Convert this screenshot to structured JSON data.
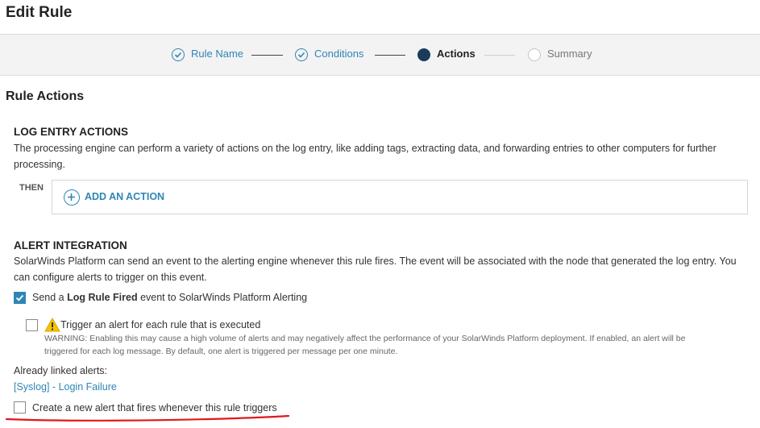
{
  "page": {
    "title": "Edit Rule"
  },
  "wizard": {
    "steps": [
      {
        "label": "Rule Name",
        "state": "done"
      },
      {
        "label": "Conditions",
        "state": "done"
      },
      {
        "label": "Actions",
        "state": "current"
      },
      {
        "label": "Summary",
        "state": "todo"
      }
    ]
  },
  "rule_actions": {
    "title": "Rule Actions"
  },
  "log_entry": {
    "title": "LOG ENTRY ACTIONS",
    "description_line1": "The processing engine can perform a variety of actions on the log entry, like adding tags, extracting data, and forwarding entries to other computers for further",
    "description_line2": "processing.",
    "then_label": "THEN",
    "add_action_label": "ADD AN ACTION"
  },
  "alert_integration": {
    "title": "ALERT INTEGRATION",
    "description_line1": "SolarWinds Platform can send an event to the alerting engine whenever this rule fires. The event will be associated with the node that generated the log entry. You",
    "description_line2": "can configure alerts to trigger on this event.",
    "send_event": {
      "checked": true,
      "label_prefix": "Send a ",
      "label_bold": "Log Rule Fired",
      "label_suffix": " event to SolarWinds Platform Alerting"
    },
    "trigger_each": {
      "checked": false,
      "label": "Trigger an alert for each rule that is executed",
      "warning_line1": "WARNING: Enabling this may cause a high volume of alerts and may negatively affect the performance of your SolarWinds Platform deployment. If enabled, an alert will be",
      "warning_line2": "triggered for each log message. By default, one alert is triggered per message per one minute."
    },
    "linked_alerts_label": "Already linked alerts:",
    "linked_alert": "[Syslog] - Login Failure",
    "create_alert": {
      "checked": false,
      "label": "Create a new alert that fires whenever this rule triggers"
    }
  },
  "colors": {
    "accent": "#2f86b5",
    "current_step": "#1b3b5a",
    "warning": "#f5c400",
    "annotation": "#e0181b"
  }
}
